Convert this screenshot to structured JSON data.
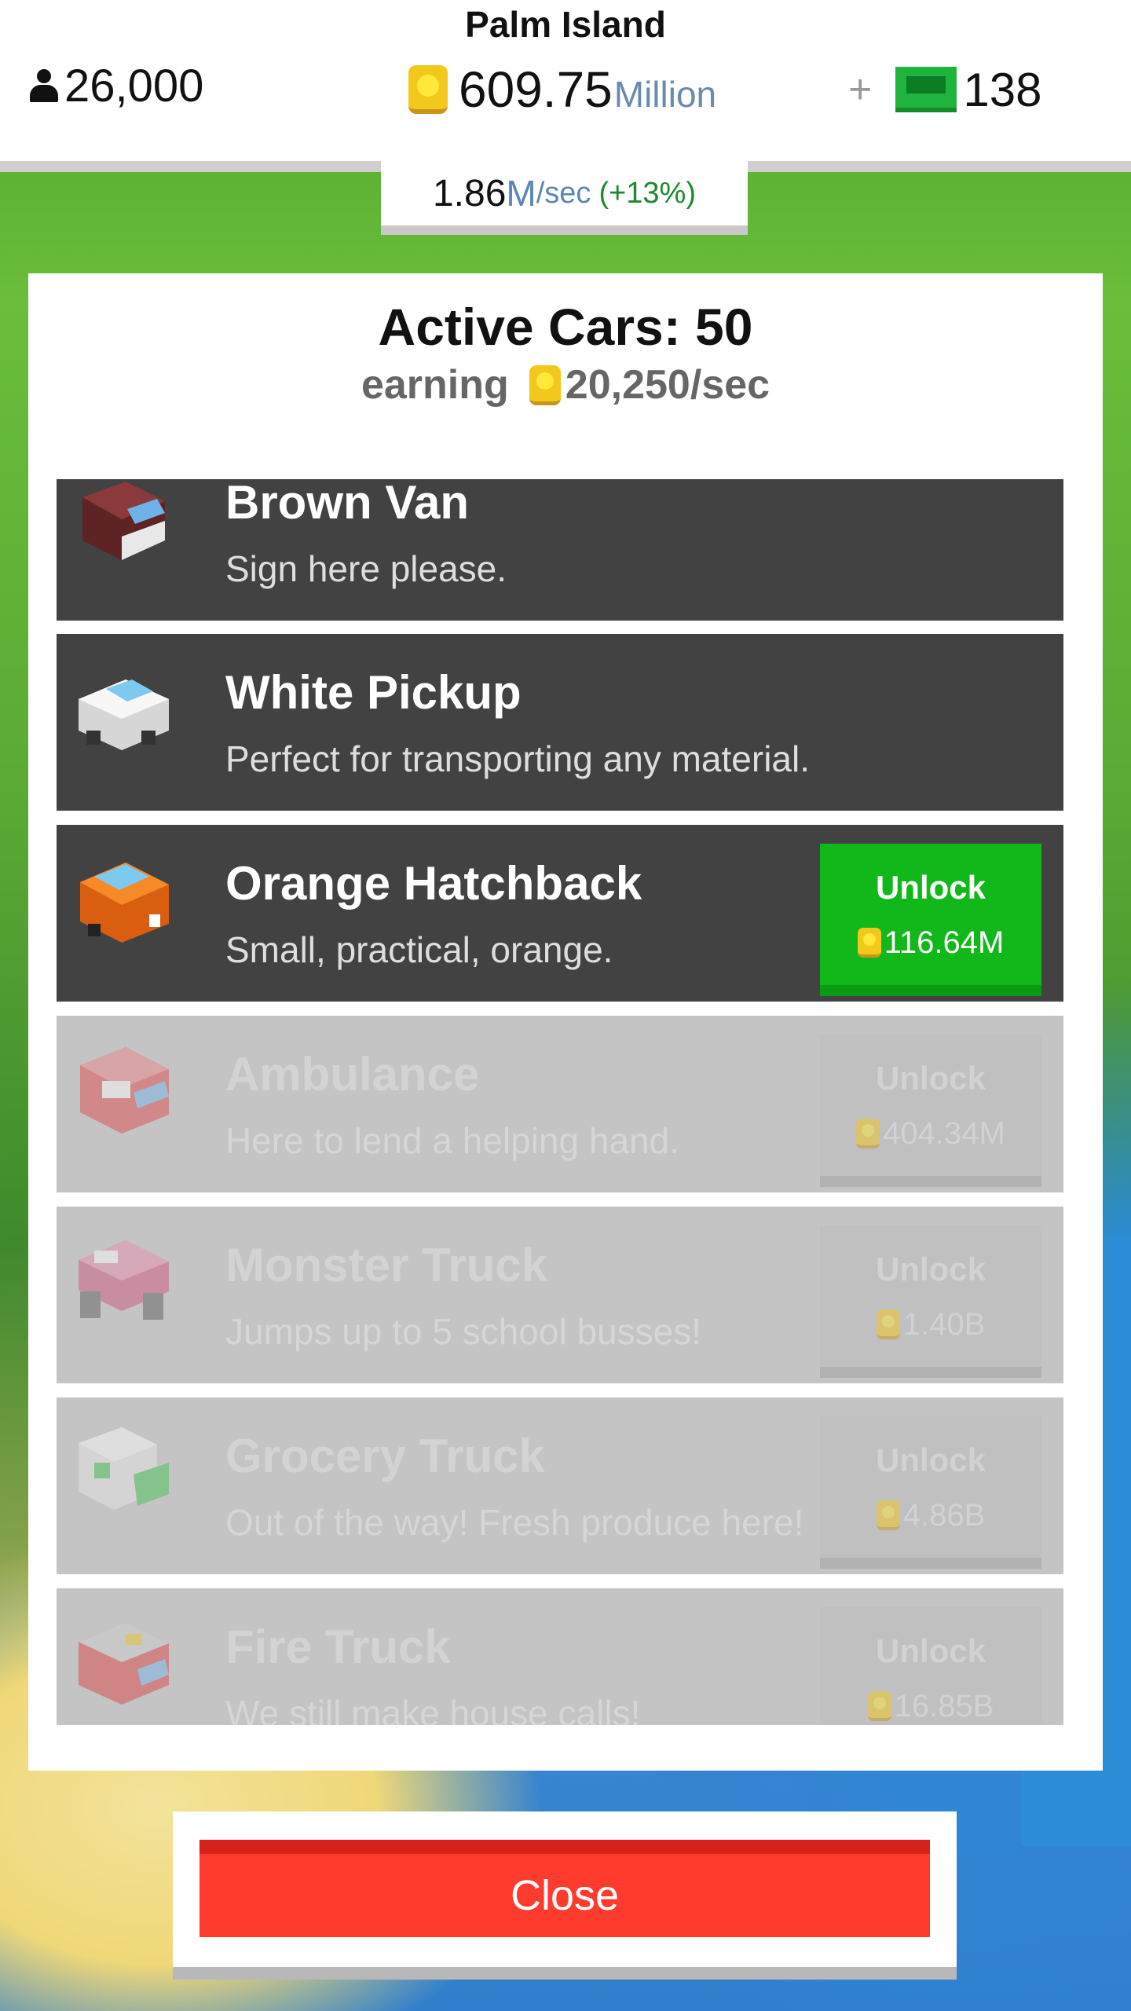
{
  "header": {
    "island_name": "Palm Island",
    "population": "26,000",
    "money_value": "609.75",
    "money_unit": "Million",
    "plus_symbol": "+",
    "cash": "138"
  },
  "rate": {
    "value": "1.86",
    "unit": "M",
    "per": "/sec",
    "bonus": "(+13%)"
  },
  "panel": {
    "title": "Active Cars: 50",
    "earning_label": "earning",
    "earning_value": "20,250/sec"
  },
  "cars": [
    {
      "name": "Brown Van",
      "desc": "Sign here please.",
      "state": "unlocked",
      "icon": "brown-van-icon",
      "colors": [
        "#7a3030",
        "#6fb2e8",
        "#e8e8e8"
      ]
    },
    {
      "name": "White Pickup",
      "desc": "Perfect for transporting any material.",
      "state": "unlocked",
      "icon": "white-pickup-icon",
      "colors": [
        "#f4f4f4",
        "#7ec9ee",
        "#d0d0d0"
      ]
    },
    {
      "name": "Orange Hatchback",
      "desc": "Small, practical, orange.",
      "state": "available",
      "icon": "orange-hatchback-icon",
      "button": "Unlock",
      "price": "116.64M",
      "colors": [
        "#f57a16",
        "#7ec9ee",
        "#2a2a2a"
      ]
    },
    {
      "name": "Ambulance",
      "desc": "Here to lend a helping hand.",
      "state": "locked",
      "icon": "ambulance-icon",
      "button": "Unlock",
      "price": "404.34M",
      "colors": [
        "#ef4a4a",
        "#ffffff",
        "#6fb2e8"
      ]
    },
    {
      "name": "Monster Truck",
      "desc": "Jumps up to 5 school busses!",
      "state": "locked",
      "icon": "monster-truck-icon",
      "button": "Unlock",
      "price": "1.40B",
      "colors": [
        "#e15a88",
        "#ffffff",
        "#555555"
      ]
    },
    {
      "name": "Grocery Truck",
      "desc": "Out of the way! Fresh produce here!",
      "state": "locked",
      "icon": "grocery-truck-icon",
      "button": "Unlock",
      "price": "4.86B",
      "colors": [
        "#ffffff",
        "#38c24a",
        "#888888"
      ]
    },
    {
      "name": "Fire Truck",
      "desc": "We still make house calls!",
      "state": "locked",
      "icon": "fire-truck-icon",
      "button": "Unlock",
      "price": "16.85B",
      "colors": [
        "#ef3a3a",
        "#cfcfcf",
        "#6fb2e8"
      ]
    }
  ],
  "close_label": "Close"
}
